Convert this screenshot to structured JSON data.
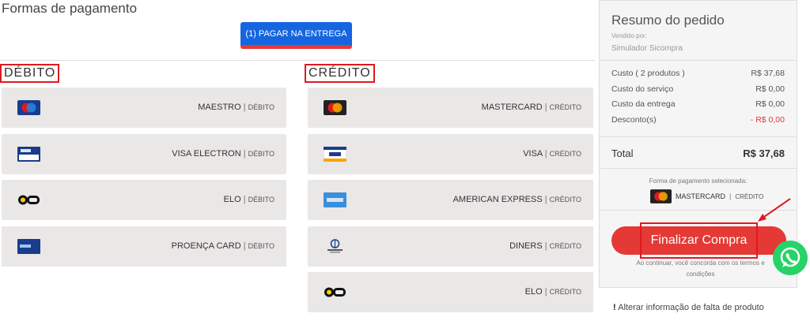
{
  "page": {
    "title": "Formas de pagamento",
    "pay_on_delivery_button": "(1) PAGAR NA ENTREGA"
  },
  "debit": {
    "title": "DÉBITO",
    "cards": [
      {
        "name": "MAESTRO",
        "type": "DÉBITO",
        "icon": "maestro-icon"
      },
      {
        "name": "VISA ELECTRON",
        "type": "DÉBITO",
        "icon": "visa-electron-icon"
      },
      {
        "name": "ELO",
        "type": "DÉBITO",
        "icon": "elo-icon"
      },
      {
        "name": "PROENÇA CARD",
        "type": "DÉBITO",
        "icon": "proenca-card-icon"
      }
    ]
  },
  "credit": {
    "title": "CRÉDITO",
    "cards": [
      {
        "name": "MASTERCARD",
        "type": "CRÉDITO",
        "icon": "mastercard-icon"
      },
      {
        "name": "VISA",
        "type": "CRÉDITO",
        "icon": "visa-icon"
      },
      {
        "name": "AMERICAN EXPRESS",
        "type": "CRÉDITO",
        "icon": "amex-icon"
      },
      {
        "name": "DINERS",
        "type": "CRÉDITO",
        "icon": "diners-icon"
      },
      {
        "name": "ELO",
        "type": "CRÉDITO",
        "icon": "elo-icon"
      }
    ]
  },
  "summary": {
    "title": "Resumo do pedido",
    "sold_by_label": "Vendido por:",
    "seller": "Simulador Sicompra",
    "rows": [
      {
        "label": "Custo ( 2 produtos )",
        "value": "R$ 37,68"
      },
      {
        "label": "Custo do serviço",
        "value": "R$ 0,00"
      },
      {
        "label": "Custo da entrega",
        "value": "R$ 0,00"
      },
      {
        "label": "Desconto(s)",
        "value": "- R$ 0,00"
      }
    ],
    "total_label": "Total",
    "total_value": "R$ 37,68",
    "selected_label": "Forma de pagamento selecionada:",
    "selected_name": "MASTERCARD",
    "selected_type": "CRÉDITO",
    "finalize_button": "Finalizar Compra",
    "terms_line1": "Ao continuar, você concorda com os termos e",
    "terms_line2": "condições"
  },
  "alert": {
    "mark": "!",
    "text": "Alterar informação de falta de produto"
  },
  "colors": {
    "accent_blue": "#1565e0",
    "accent_red": "#e53935",
    "whatsapp_green": "#25d366"
  }
}
